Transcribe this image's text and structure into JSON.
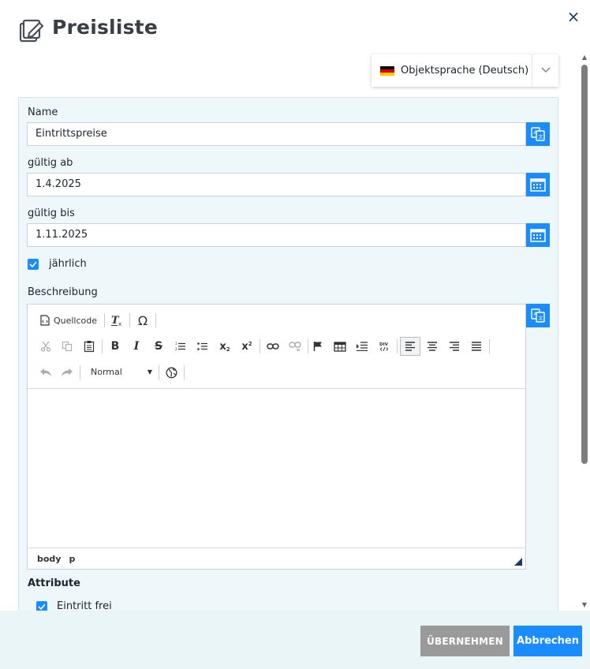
{
  "dialog": {
    "title": "Preisliste",
    "close_icon": "×"
  },
  "language": {
    "selected": "Objektsprache (Deutsch)"
  },
  "form": {
    "name": {
      "label": "Name",
      "value": "Eintrittspreise"
    },
    "valid_from": {
      "label": "gültig ab",
      "value": "1.4.2025"
    },
    "valid_to": {
      "label": "gültig bis",
      "value": "1.11.2025"
    },
    "yearly": {
      "label": "jährlich",
      "checked": true
    },
    "description": {
      "label": "Beschreibung"
    },
    "attributes": {
      "label": "Attribute",
      "items": [
        {
          "label": "Eintritt frei",
          "checked": true
        }
      ]
    }
  },
  "editor": {
    "source_label": "Quellcode",
    "format_value": "Normal",
    "path": [
      "body",
      "p"
    ],
    "icons": [
      "source-icon",
      "clear-format-icon",
      "special-char-icon",
      "cut-icon",
      "copy-icon",
      "paste-icon",
      "bold-icon",
      "italic-icon",
      "strike-icon",
      "numbered-list-icon",
      "bullet-list-icon",
      "subscript-icon",
      "superscript-icon",
      "link-icon",
      "unlink-icon",
      "anchor-icon",
      "table-icon",
      "indent-icon",
      "div-icon",
      "align-left-icon",
      "align-center-icon",
      "align-right-icon",
      "align-justify-icon",
      "undo-icon",
      "redo-icon",
      "globe-icon"
    ]
  },
  "footer": {
    "apply_label": "ÜBERNEHMEN",
    "cancel_label": "Abbrechen"
  },
  "colors": {
    "accent": "#1a8cff",
    "panel": "#eef8fb",
    "footer": "#eaf5f8",
    "apply": "#9a9a9a",
    "title": "#3a3f47"
  }
}
